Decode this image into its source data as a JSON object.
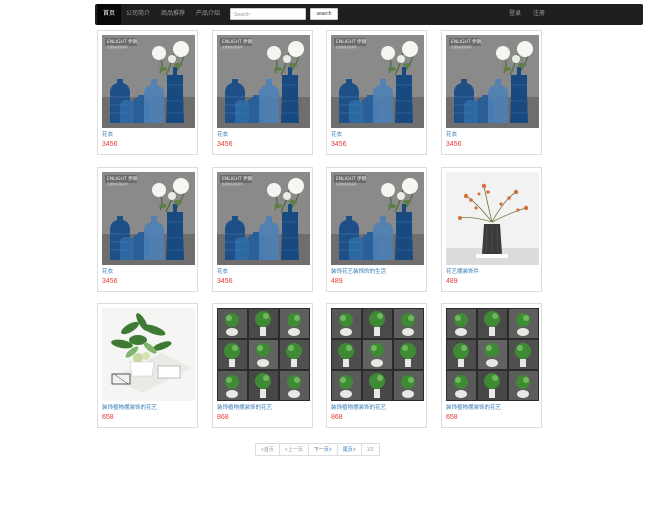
{
  "nav": {
    "items": [
      "首页",
      "公司简介",
      "商品推荐",
      "产品介绍"
    ],
    "search_placeholder": "Search",
    "search_button": "search",
    "login": "登录",
    "register": "注册"
  },
  "products": [
    {
      "name": "花衣",
      "price": "3456",
      "image": "blue-vases-photo"
    },
    {
      "name": "花衣",
      "price": "3456",
      "image": "blue-vases-photo"
    },
    {
      "name": "花衣",
      "price": "3456",
      "image": "blue-vases-photo"
    },
    {
      "name": "花衣",
      "price": "3456",
      "image": "blue-vases-photo"
    },
    {
      "name": "花衣",
      "price": "3456",
      "image": "blue-vases-photo"
    },
    {
      "name": "花衣",
      "price": "3456",
      "image": "blue-vases-photo"
    },
    {
      "name": "装饰花艺装饰的的生活",
      "price": "489",
      "image": "blue-vases-photo"
    },
    {
      "name": "花艺摆装饰件",
      "price": "489",
      "image": "dry-flower-vase-photo"
    },
    {
      "name": "装饰植物摆装饰的花艺",
      "price": "658",
      "image": "green-plant-photo"
    },
    {
      "name": "装饰植物摆装饰的花艺",
      "price": "868",
      "image": "potted-plants-grid-photo"
    },
    {
      "name": "装饰植物摆装饰的花艺",
      "price": "868",
      "image": "potted-plants-grid-photo"
    },
    {
      "name": "装饰植物摆装饰的花艺",
      "price": "658",
      "image": "potted-plants-grid-photo"
    }
  ],
  "pagination": {
    "first": "<首页",
    "prev": "<上一页",
    "next": "下一页>",
    "last": "尾页>",
    "page_info": "1/3"
  },
  "colors": {
    "navbar": "#1f1f1f",
    "link": "#337ab7",
    "price": "#e4393c"
  }
}
